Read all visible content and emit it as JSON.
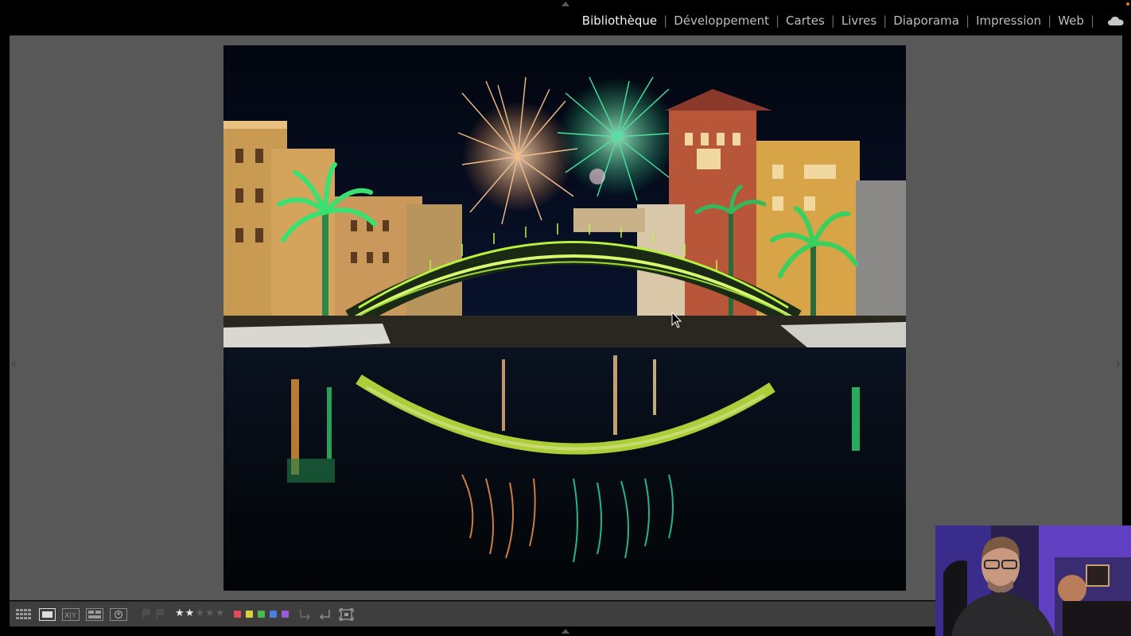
{
  "modules": {
    "items": [
      "Bibliothèque",
      "Développement",
      "Cartes",
      "Livres",
      "Diaporama",
      "Impression",
      "Web"
    ],
    "active": "Bibliothèque"
  },
  "toolbar": {
    "view_modes": [
      "grid-view",
      "loupe-view",
      "compare-view",
      "survey-view",
      "people-view"
    ],
    "active_view": "loupe-view",
    "rating": 2,
    "rating_max": 5,
    "color_labels": [
      "#e04a5a",
      "#d8d040",
      "#4cb84c",
      "#4a7ed8",
      "#9a5ad0"
    ]
  },
  "icons": [
    "cloud-icon",
    "flag-icon",
    "rotate-left-icon",
    "rotate-right-icon",
    "crop-icon",
    "cursor-icon"
  ]
}
